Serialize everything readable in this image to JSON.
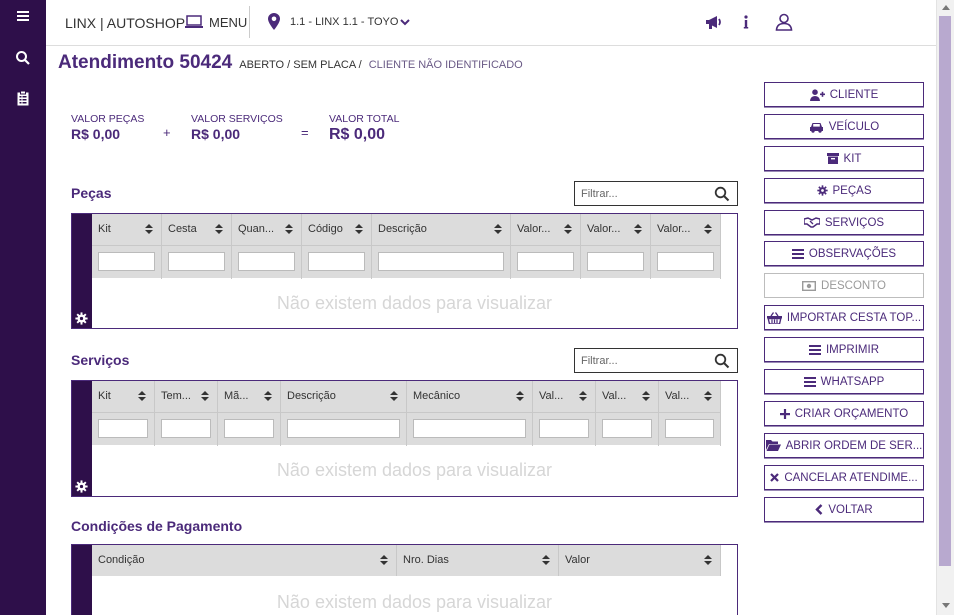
{
  "topbar": {
    "brand": "LINX | AUTOSHOP",
    "menu_label": "MENU",
    "store": "1.1 - LINX 1.1 - TOYO"
  },
  "header": {
    "title": "Atendimento 50424",
    "status": "ABERTO / SEM PLACA /",
    "client_status": "CLIENTE NÃO IDENTIFICADO"
  },
  "totals": {
    "parts_label": "VALOR PEÇAS",
    "parts_value": "R$ 0,00",
    "plus": "+",
    "services_label": "VALOR SERVIÇOS",
    "services_value": "R$ 0,00",
    "equals": "=",
    "total_label": "VALOR TOTAL",
    "total_value": "R$ 0,00"
  },
  "parts": {
    "title": "Peças",
    "filter_placeholder": "Filtrar...",
    "columns": [
      "Kit",
      "Cesta",
      "Quan...",
      "Código",
      "Descrição",
      "Valor...",
      "Valor...",
      "Valor..."
    ],
    "empty": "Não existem dados para visualizar"
  },
  "services": {
    "title": "Serviços",
    "filter_placeholder": "Filtrar...",
    "columns": [
      "Kit",
      "Tem...",
      "Mã...",
      "Descrição",
      "Mecânico",
      "Val...",
      "Val...",
      "Val..."
    ],
    "empty": "Não existem dados para visualizar"
  },
  "payment": {
    "title": "Condições de Pagamento",
    "columns": [
      "Condição",
      "Nro. Dias",
      "Valor"
    ],
    "empty": "Não existem dados para visualizar"
  },
  "actions": {
    "cliente": "CLIENTE",
    "veiculo": "VEÍCULO",
    "kit": "KIT",
    "pecas": "PEÇAS",
    "servicos": "SERVIÇOS",
    "observacoes": "OBSERVAÇÕES",
    "desconto": "DESCONTO",
    "importar": "IMPORTAR CESTA TOP...",
    "imprimir": "IMPRIMIR",
    "whatsapp": "WHATSAPP",
    "criar": "CRIAR ORÇAMENTO",
    "abrir": "ABRIR ORDEM DE SER...",
    "cancelar": "CANCELAR ATENDIME...",
    "voltar": "VOLTAR"
  },
  "colors": {
    "brand_dark": "#2e0f4a",
    "accent": "#4b2a7a",
    "grid_header": "#dcdcdc"
  }
}
